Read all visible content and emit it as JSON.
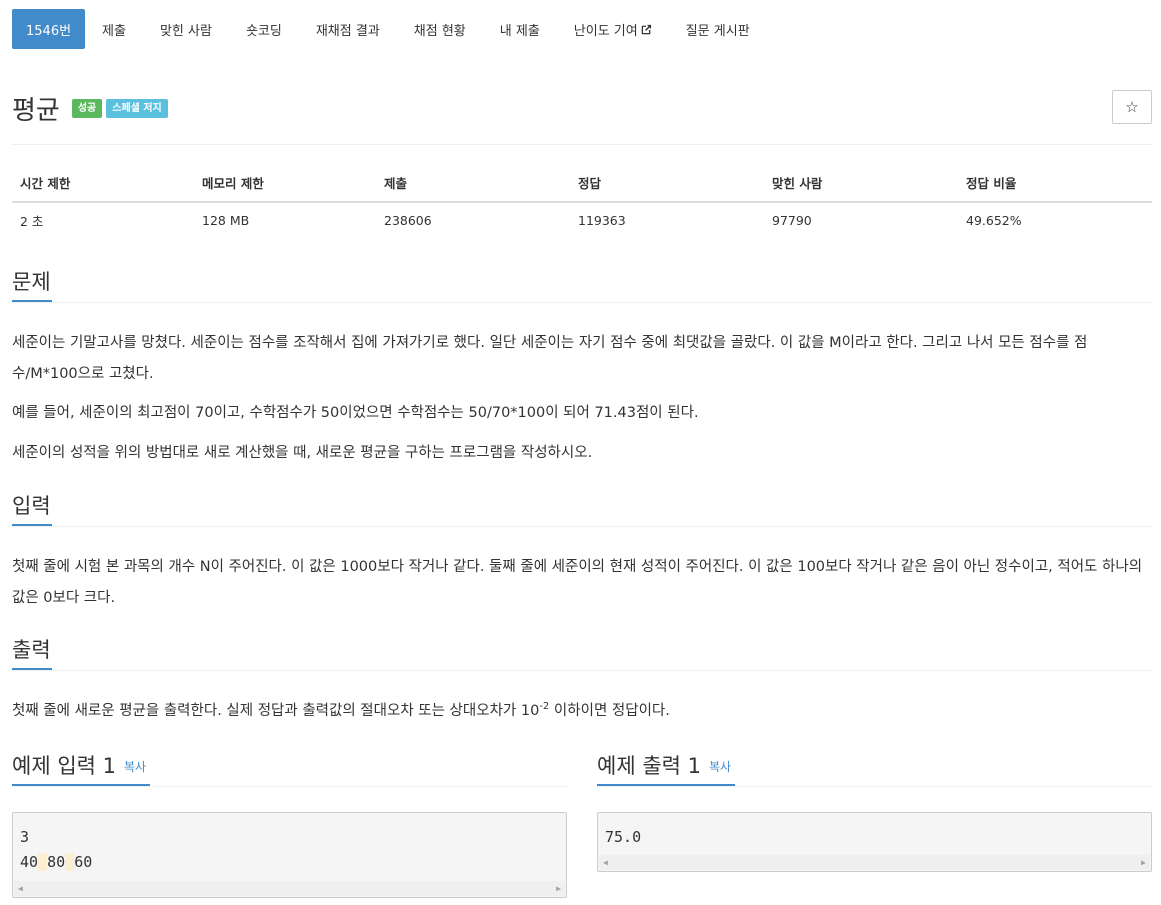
{
  "nav": [
    {
      "label": "1546번"
    },
    {
      "label": "제출"
    },
    {
      "label": "맞힌 사람"
    },
    {
      "label": "숏코딩"
    },
    {
      "label": "재채점 결과"
    },
    {
      "label": "채점 현황"
    },
    {
      "label": "내 제출"
    },
    {
      "label": "난이도 기여"
    },
    {
      "label": "질문 게시판"
    }
  ],
  "title": "평균",
  "badges": {
    "success": "성공",
    "special": "스페셜 저지"
  },
  "star_glyph": "☆",
  "stats": {
    "headers": [
      "시간 제한",
      "메모리 제한",
      "제출",
      "정답",
      "맞힌 사람",
      "정답 비율"
    ],
    "values": [
      "2 초",
      "128 MB",
      "238606",
      "119363",
      "97790",
      "49.652%"
    ]
  },
  "sections": {
    "problem": {
      "heading": "문제",
      "paragraphs": [
        "세준이는 기말고사를 망쳤다. 세준이는 점수를 조작해서 집에 가져가기로 했다. 일단 세준이는 자기 점수 중에 최댓값을 골랐다. 이 값을 M이라고 한다. 그리고 나서 모든 점수를 점수/M*100으로 고쳤다.",
        "예를 들어, 세준이의 최고점이 70이고, 수학점수가 50이었으면 수학점수는 50/70*100이 되어 71.43점이 된다.",
        "세준이의 성적을 위의 방법대로 새로 계산했을 때, 새로운 평균을 구하는 프로그램을 작성하시오."
      ]
    },
    "input": {
      "heading": "입력",
      "text": "첫째 줄에 시험 본 과목의 개수 N이 주어진다. 이 값은 1000보다 작거나 같다. 둘째 줄에 세준이의 현재 성적이 주어진다. 이 값은 100보다 작거나 같은 음이 아닌 정수이고, 적어도 하나의 값은 0보다 크다."
    },
    "output": {
      "heading": "출력",
      "text_before": "첫째 줄에 새로운 평균을 출력한다. 실제 정답과 출력값의 절대오차 또는 상대오차가 10",
      "sup": "-2",
      "text_after": " 이하이면 정답이다."
    }
  },
  "samples": {
    "input": {
      "title": "예제 입력 1",
      "copy": "복사",
      "line1": "3",
      "line2_tokens": [
        "40",
        "80",
        "60"
      ]
    },
    "output": {
      "title": "예제 출력 1",
      "copy": "복사",
      "line1": "75.0"
    }
  }
}
